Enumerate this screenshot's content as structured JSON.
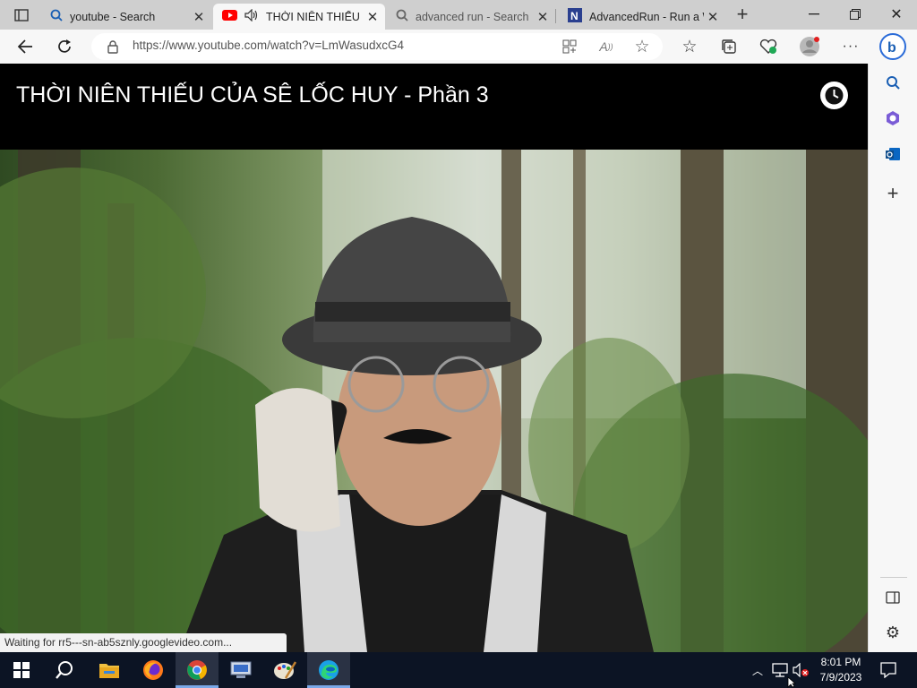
{
  "tabs": [
    {
      "title": "youtube - Search",
      "icon": "search-icon"
    },
    {
      "title": "THỜI NIÊN THIẾU C",
      "icon": "youtube-icon",
      "audio": true,
      "active": true
    },
    {
      "title": "advanced run - Search",
      "icon": "search-icon"
    },
    {
      "title": "AdvancedRun - Run a W",
      "icon": "nirsoft-icon"
    }
  ],
  "address": {
    "url": "https://www.youtube.com/watch?v=LmWasudxcG4"
  },
  "page": {
    "video_title": "THỜI NIÊN THIẾU CỦA SÊ LỐC HUY - Phần 3",
    "status": "Waiting for rr5---sn-ab5sznly.googlevideo.com..."
  },
  "taskbar": {
    "time": "8:01 PM",
    "date": "7/9/2023"
  },
  "colors": {
    "taskbar": "#0c1424",
    "tabstrip": "#cfcfcf",
    "youtube_red": "#ff0000",
    "edge_blue": "#0a66c2"
  }
}
